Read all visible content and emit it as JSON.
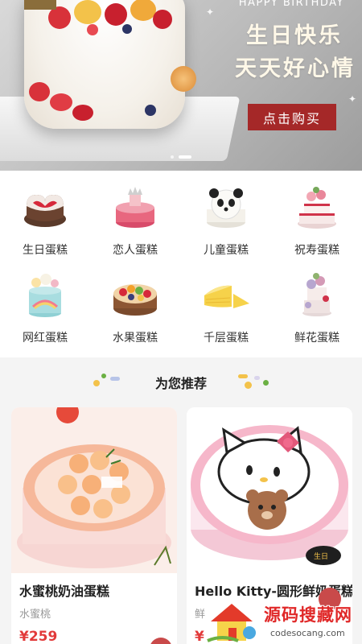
{
  "banner": {
    "happy": "HAPPY BIRTHDAY",
    "line1": "生日快乐",
    "line2": "天天好心情",
    "buy": "点击购买"
  },
  "categories": [
    {
      "label": "生日蛋糕",
      "icon": "birthday-cake-icon"
    },
    {
      "label": "恋人蛋糕",
      "icon": "lover-cake-icon"
    },
    {
      "label": "儿童蛋糕",
      "icon": "kids-cake-icon"
    },
    {
      "label": "祝寿蛋糕",
      "icon": "longevity-cake-icon"
    },
    {
      "label": "网红蛋糕",
      "icon": "trendy-cake-icon"
    },
    {
      "label": "水果蛋糕",
      "icon": "fruit-cake-icon"
    },
    {
      "label": "千层蛋糕",
      "icon": "mille-crepe-cake-icon"
    },
    {
      "label": "鲜花蛋糕",
      "icon": "flower-cake-icon"
    }
  ],
  "recommend": {
    "title": "为您推荐",
    "items": [
      {
        "name": "水蜜桃奶油蛋糕",
        "sub": "水蜜桃",
        "price": "¥259"
      },
      {
        "name": "Hello Kitty-圆形鲜奶蛋糕",
        "sub": "鲜",
        "price": "¥"
      }
    ]
  },
  "watermark": {
    "title": "源码搜藏网",
    "url": "codesocang.com"
  },
  "colors": {
    "accent": "#a52828",
    "price": "#e23a3a"
  }
}
